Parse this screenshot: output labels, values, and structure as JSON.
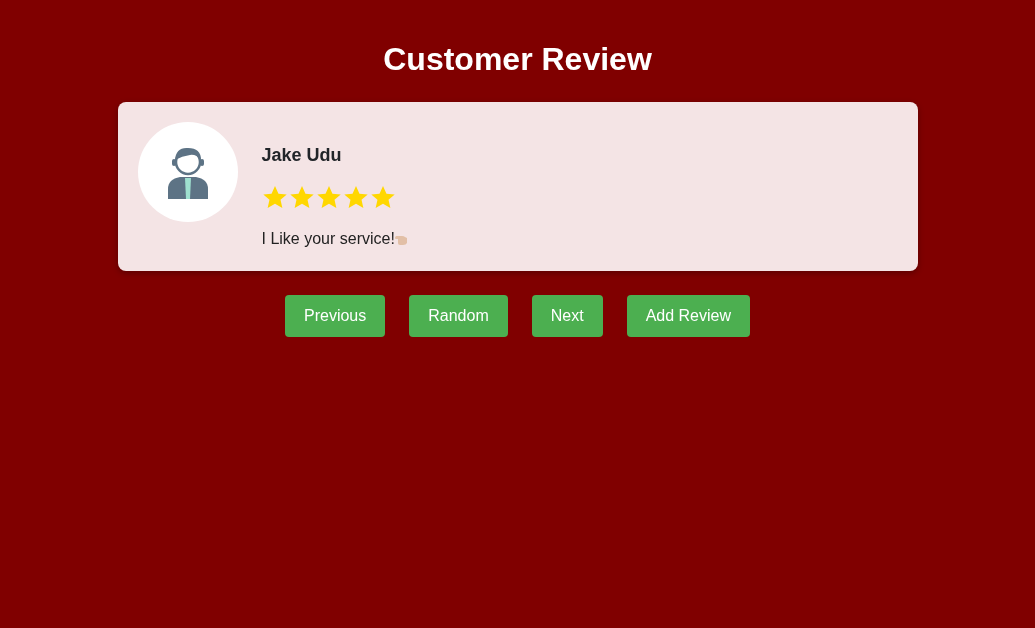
{
  "title": "Customer Review",
  "review": {
    "name": "Jake Udu",
    "stars": 5,
    "text": "I Like your service!"
  },
  "buttons": [
    "Previous",
    "Random",
    "Next",
    "Add Review"
  ]
}
